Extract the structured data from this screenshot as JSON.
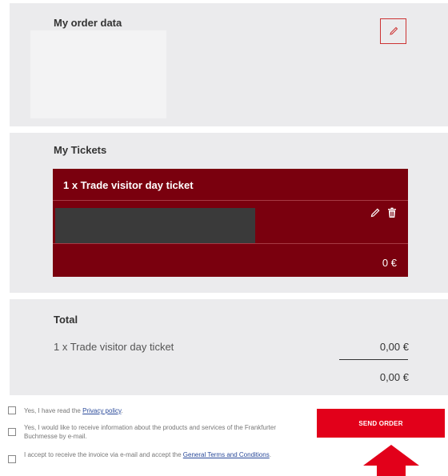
{
  "order": {
    "title": "My order data",
    "edit_icon": "pencil-icon"
  },
  "tickets": {
    "title": "My Tickets",
    "ticket": {
      "title": "1 x Trade visitor day ticket",
      "price": "0 €",
      "edit_icon": "pencil-icon",
      "delete_icon": "trash-icon"
    }
  },
  "total": {
    "title": "Total",
    "line_label": "1 x Trade visitor day ticket",
    "line_amount": "0,00 €",
    "total_amount": "0,00 €"
  },
  "consents": [
    {
      "before": "Yes, I have read the ",
      "link": "Privacy policy",
      "after": "."
    },
    {
      "text": "Yes, I would like to receive information about the products and services of the Frankfurter Buchmesse by e-mail."
    },
    {
      "before": "I accept to receive the invoice via e-mail and accept the ",
      "link": "General Terms and Conditions",
      "after": "."
    }
  ],
  "send_button": "SEND ORDER",
  "colors": {
    "accent": "#e2001a",
    "ticket_bg": "#7a000e",
    "panel_bg": "#ebebed"
  }
}
